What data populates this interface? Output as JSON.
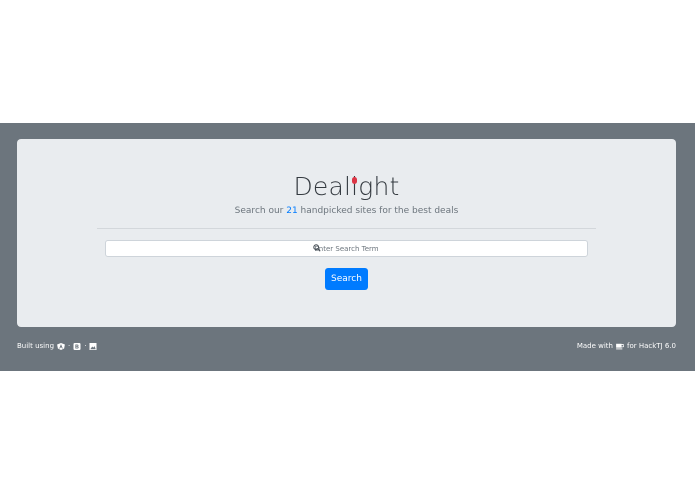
{
  "header": {
    "logo_prefix": "Deal",
    "logo_bulb_letter": "i",
    "logo_suffix": "ght",
    "accent_color": "#dc3545"
  },
  "subtitle": {
    "before": "Search our ",
    "count": "21",
    "after": " handpicked sites for the best deals"
  },
  "search": {
    "placeholder": "Enter Search Term",
    "value": "",
    "icon": "search-icon",
    "button_label": "Search",
    "button_color": "#007bff"
  },
  "footer": {
    "left_text": "Built using",
    "left_icons": [
      "angular-icon",
      "bootstrap-icon",
      "image-icon"
    ],
    "left_separator": "·",
    "right_prefix": "Made with",
    "right_icon": "coffee-icon",
    "right_suffix": "for HackTJ 6.0"
  },
  "colors": {
    "band": "#6c757d",
    "card": "#e9ecef"
  }
}
